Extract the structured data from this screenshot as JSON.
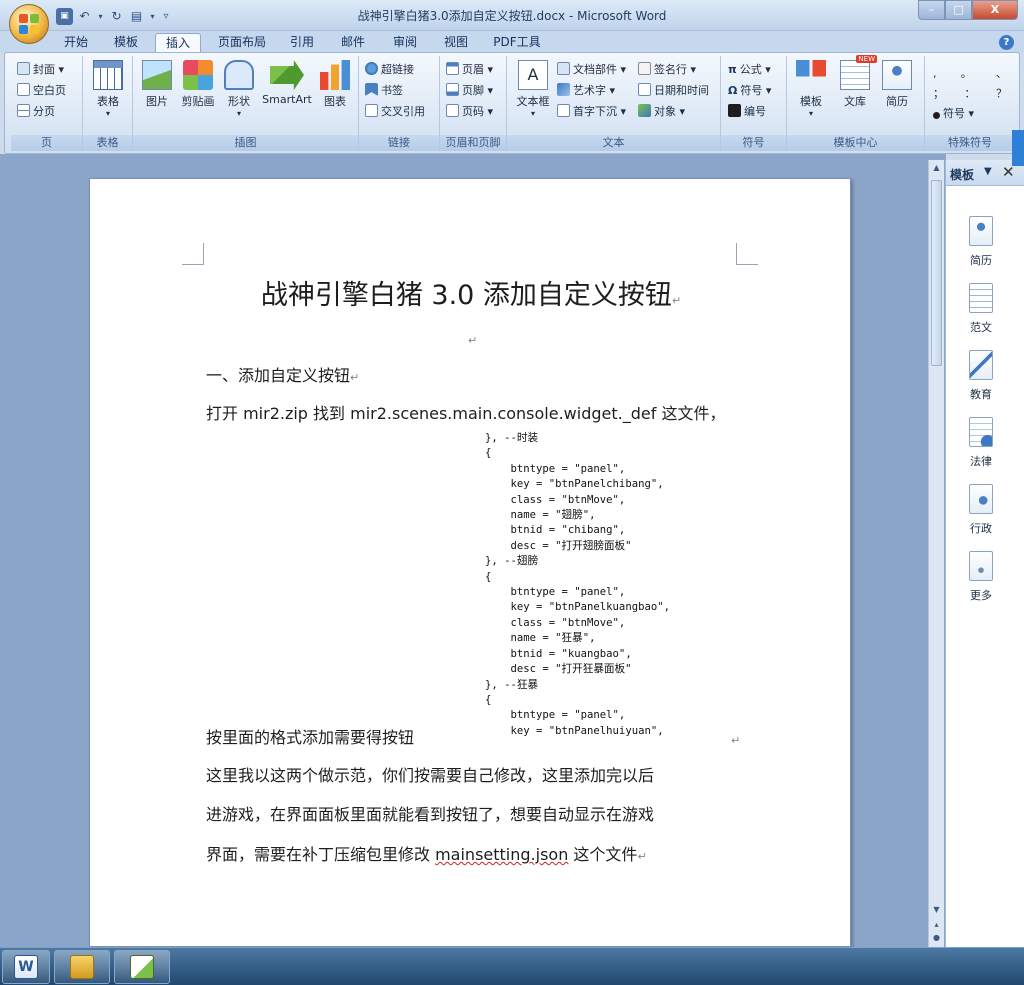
{
  "window": {
    "title": "战神引擎白猪3.0添加自定义按钮.docx - Microsoft Word",
    "controls": {
      "minimize": "–",
      "maximize": "□",
      "close": "X"
    }
  },
  "quick_access": [
    "save-icon",
    "undo-icon",
    "redo-icon",
    "print-preview-icon",
    "customize-dropdown-icon"
  ],
  "tabs": [
    {
      "label": "开始"
    },
    {
      "label": "模板"
    },
    {
      "label": "插入",
      "active": true
    },
    {
      "label": "页面布局"
    },
    {
      "label": "引用"
    },
    {
      "label": "邮件"
    },
    {
      "label": "审阅"
    },
    {
      "label": "视图"
    },
    {
      "label": "PDF工具"
    }
  ],
  "ribbon": {
    "groups": [
      {
        "label": "页",
        "items": [
          "封面 ▾",
          "空白页",
          "分页"
        ]
      },
      {
        "label": "表格",
        "items": [
          "表格"
        ]
      },
      {
        "label": "插图",
        "items": [
          "图片",
          "剪贴画",
          "形状",
          "SmartArt",
          "图表"
        ]
      },
      {
        "label": "链接",
        "items": [
          "超链接",
          "书签",
          "交叉引用"
        ]
      },
      {
        "label": "页眉和页脚",
        "items": [
          "页眉 ▾",
          "页脚 ▾",
          "页码 ▾"
        ]
      },
      {
        "label": "文本",
        "items": [
          "文本框",
          "文档部件 ▾",
          "艺术字 ▾",
          "首字下沉 ▾",
          "签名行 ▾",
          "日期和时间",
          "对象 ▾"
        ]
      },
      {
        "label": "符号",
        "items": [
          "公式 ▾",
          "符号 ▾",
          "编号"
        ]
      },
      {
        "label": "模板中心",
        "items": [
          "模板",
          "文库",
          "简历"
        ],
        "badge": "NEW"
      },
      {
        "label": "特殊符号",
        "items": [
          ",",
          "。",
          "、",
          "；",
          "：",
          "？",
          "符号 ▾"
        ]
      }
    ]
  },
  "document": {
    "title": "战神引擎白猪 3.0 添加自定义按钮",
    "heading": "一、添加自定义按钮",
    "intro": "打开 mir2.zip 找到 mir2.scenes.main.console.widget._def 这文件，",
    "code": "}, --时装\n{\n    btntype = \"panel\",\n    key = \"btnPanelchibang\",\n    class = \"btnMove\",\n    name = \"翅膀\",\n    btnid = \"chibang\",\n    desc = \"打开翅膀面板\"\n}, --翅膀\n{\n    btntype = \"panel\",\n    key = \"btnPanelkuangbao\",\n    class = \"btnMove\",\n    name = \"狂暴\",\n    btnid = \"kuangbao\",\n    desc = \"打开狂暴面板\"\n}, --狂暴\n{\n    btntype = \"panel\",\n    key = \"btnPanelhuiyuan\",",
    "line_format": "按里面的格式添加需要得按钮",
    "line1": "这里我以这两个做示范，你们按需要自己修改，这里添加完以后",
    "line2": "进游戏，在界面面板里面就能看到按钮了，想要自动显示在游戏",
    "line3_before": "界面，需要在补丁压缩包里修改 ",
    "line3_file": "mainsetting.json",
    "line3_after": " 这个文件",
    "para_mark": "↵"
  },
  "task_pane": {
    "title": "模板",
    "items": [
      {
        "label": "简历",
        "icon": "resume-icon"
      },
      {
        "label": "范文",
        "icon": "sample-doc-icon"
      },
      {
        "label": "教育",
        "icon": "education-icon"
      },
      {
        "label": "法律",
        "icon": "law-icon"
      },
      {
        "label": "行政",
        "icon": "admin-icon"
      },
      {
        "label": "更多",
        "icon": "more-icon"
      }
    ]
  },
  "taskbar": {
    "buttons": [
      "word-icon",
      "explorer-icon",
      "notepad-icon"
    ]
  },
  "colors": {
    "accent": "#2b5797",
    "ribbon_bg": "#dbe7f5",
    "page_bg": "#ffffff",
    "doc_area": "#8aa5c8"
  }
}
